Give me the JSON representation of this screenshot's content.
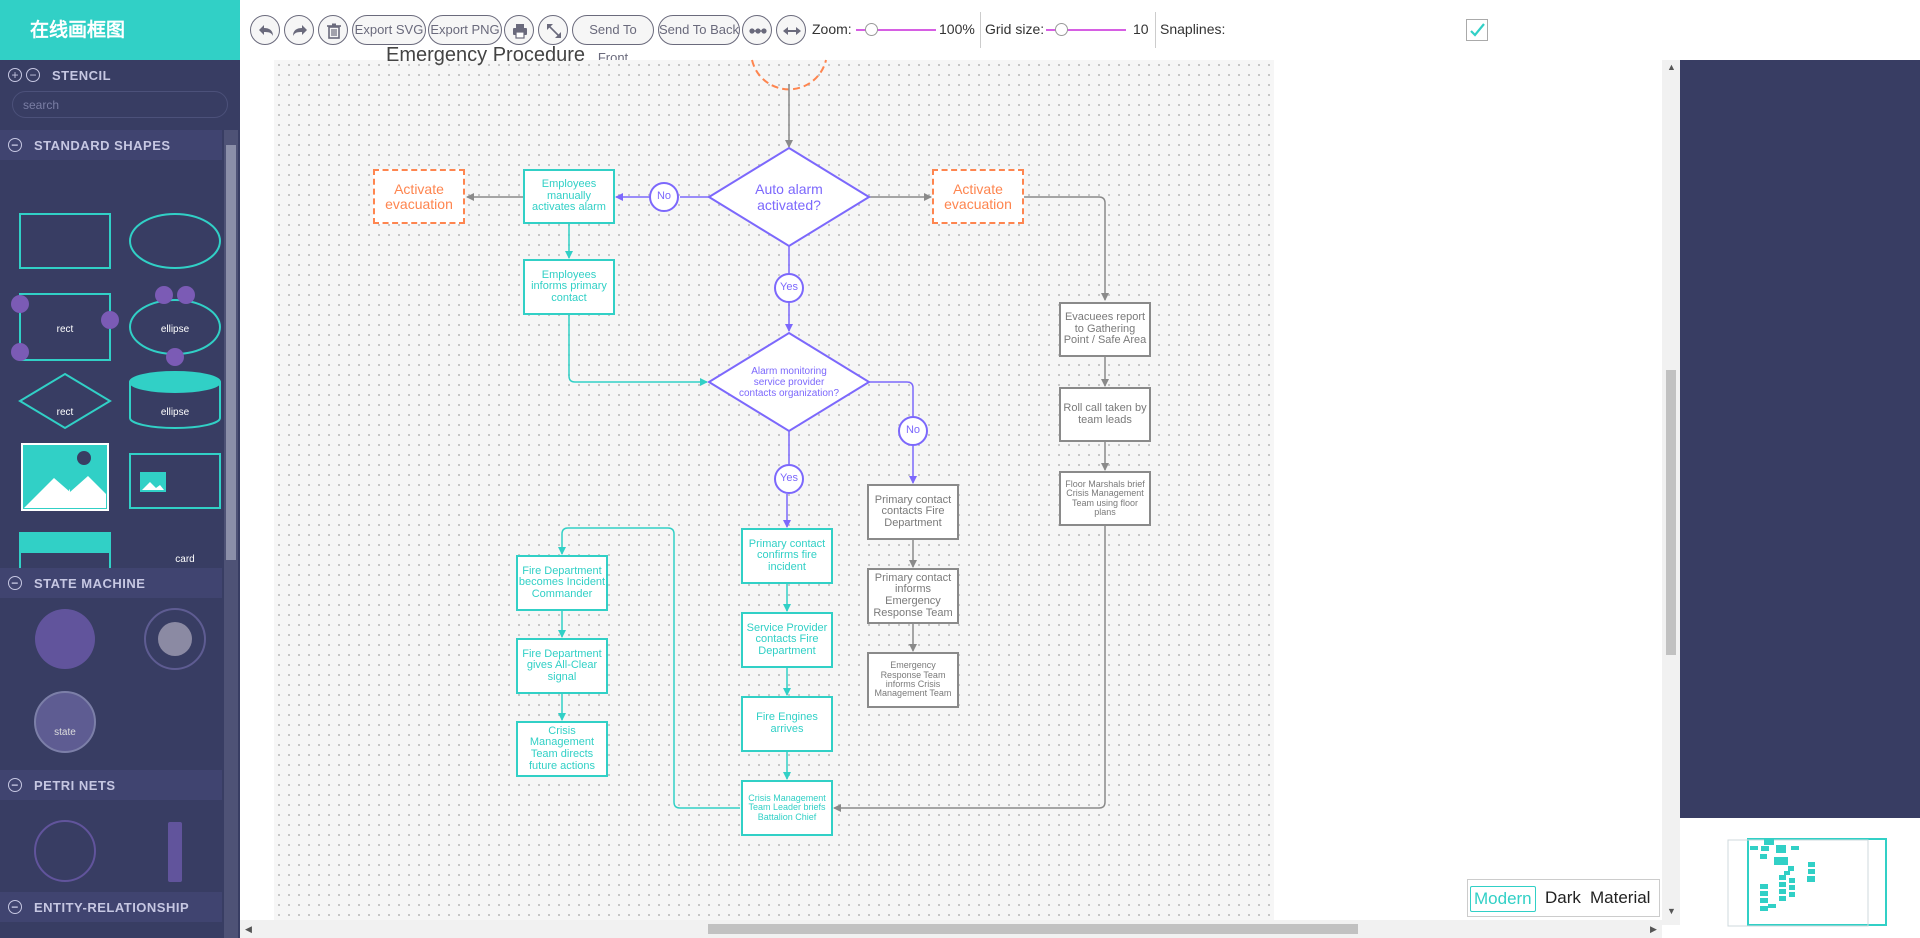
{
  "app": {
    "logo": "在线画框图"
  },
  "stencil": {
    "title": "STENCIL",
    "search_placeholder": "search",
    "groups": {
      "standard": "STANDARD SHAPES",
      "state_machine": "STATE MACHINE",
      "petri": "PETRI NETS",
      "er": "ENTITY-RELATIONSHIP"
    },
    "shapes": {
      "rect": "rect",
      "ellipse": "ellipse",
      "rect2": "rect",
      "ellipse2": "ellipse",
      "rhombus": "rhombus",
      "card": "card",
      "header": "header",
      "state": "state"
    }
  },
  "toolbar": {
    "export_svg": "Export SVG",
    "export_png": "Export PNG",
    "send_front": "Send To Front",
    "send_back": "Send To Back",
    "zoom_label": "Zoom:",
    "zoom_value": "100%",
    "grid_label": "Grid size:",
    "grid_value": "10",
    "snaplines_label": "Snaplines:",
    "icons": [
      "undo-icon",
      "redo-icon",
      "trash-icon",
      "print-icon",
      "zoom-fit-icon",
      "layout-icon",
      "fit-width-icon"
    ]
  },
  "diagram": {
    "title": "Emergency Procedure",
    "nodes": {
      "activate1": "Activate evacuation",
      "manual": "Employees manually activates alarm",
      "auto": "Auto alarm activated?",
      "activate2": "Activate evacuation",
      "informs": "Employees informs primary contact",
      "monitoring": "Alarm monitoring service provider contacts organization?",
      "evacuees": "Evacuees report to Gathering Point / Safe Area",
      "rollcall": "Roll call taken by team leads",
      "marshals": "Floor Marshals brief Crisis Management Team using floor plans",
      "primary_fire": "Primary contact contacts Fire Department",
      "primary_ert": "Primary contact informs Emergency Response Team",
      "ert_informs": "Emergency Response Team informs Crisis Management Team",
      "confirms": "Primary contact confirms fire incident",
      "provider": "Service Provider contacts Fire Department",
      "engines": "Fire Engines arrives",
      "cmt_leader": "Crisis Management Team Leader briefs Battalion Chief",
      "fd_commander": "Fire Department becomes Incident Commander",
      "all_clear": "Fire Department gives All-Clear signal",
      "cmt_directs": "Crisis Management Team directs future actions"
    },
    "labels": {
      "no1": "No",
      "yes1": "Yes",
      "no2": "No",
      "yes2": "Yes"
    }
  },
  "themes": {
    "modern": "Modern",
    "dark": "Dark",
    "material": "Material",
    "selected": "Modern"
  },
  "colors": {
    "teal": "#31d0c6",
    "purple": "#7c68fc",
    "orange": "#fe854f",
    "grey": "#8a8a8a",
    "sidebar": "#383d63"
  }
}
